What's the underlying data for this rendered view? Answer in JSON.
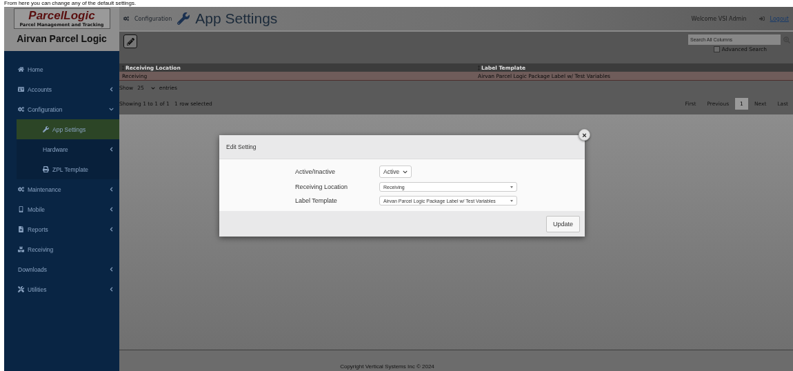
{
  "caption": "From here you can change any of the default settings.",
  "sidebar": {
    "logo_title": "ParcelLogic",
    "logo_subtitle": "Parcel Management and Tracking",
    "app_name": "Airvan Parcel Logic",
    "items": [
      {
        "label": "Home",
        "has_children": false,
        "selected": false
      },
      {
        "label": "Accounts",
        "has_children": true,
        "expanded": false,
        "selected": false
      },
      {
        "label": "Configuration",
        "has_children": true,
        "expanded": true,
        "selected": false,
        "children": [
          {
            "label": "App Settings",
            "has_children": false,
            "selected": true
          },
          {
            "label": "Hardware",
            "has_children": true,
            "expanded": false,
            "selected": false
          },
          {
            "label": "ZPL Template",
            "has_children": false,
            "selected": false
          }
        ]
      },
      {
        "label": "Maintenance",
        "has_children": true,
        "expanded": false,
        "selected": false
      },
      {
        "label": "Mobile",
        "has_children": true,
        "expanded": false,
        "selected": false
      },
      {
        "label": "Reports",
        "has_children": true,
        "expanded": false,
        "selected": false
      },
      {
        "label": "Receiving",
        "has_children": false,
        "selected": false
      },
      {
        "label": "Downloads",
        "has_children": true,
        "expanded": false,
        "selected": false
      },
      {
        "label": "Utilities",
        "has_children": true,
        "expanded": false,
        "selected": false
      }
    ]
  },
  "header": {
    "breadcrumb": "Configuration",
    "title": "App Settings",
    "welcome": "Welcome VSI Admin",
    "logout": "Logout"
  },
  "toolbar": {
    "search": {
      "placeholder": "Search All Columns"
    },
    "advanced_search": {
      "label": "Advanced Search",
      "checked": false
    }
  },
  "table": {
    "columns": [
      "Receiving Location",
      "Label Template"
    ],
    "rows": [
      {
        "cells": [
          "Receiving",
          "Airvan Parcel Logic Package Label w/ Test Variables"
        ],
        "selected": true
      }
    ]
  },
  "length": {
    "show": "Show",
    "value": "25",
    "entries": "entries"
  },
  "info": {
    "showing": "Showing 1 to 1 of 1",
    "selected": "1 row selected"
  },
  "pagination": [
    {
      "label": "First",
      "selected": false
    },
    {
      "label": "Previous",
      "selected": false
    },
    {
      "label": "1",
      "selected": true
    },
    {
      "label": "Next",
      "selected": false
    },
    {
      "label": "Last",
      "selected": false
    }
  ],
  "modal": {
    "title": "Edit Setting",
    "close": "×",
    "fields": [
      {
        "label": "Active/Inactive",
        "value": "Active",
        "kind": "small"
      },
      {
        "label": "Receiving Location",
        "value": "Receiving",
        "kind": "wide"
      },
      {
        "label": "Label Template",
        "value": "Airvan Parcel Logic Package Label w/ Test Variables",
        "kind": "wide"
      }
    ],
    "button": "Update"
  },
  "footer": "Copyright Vertical Systems Inc © 2024"
}
